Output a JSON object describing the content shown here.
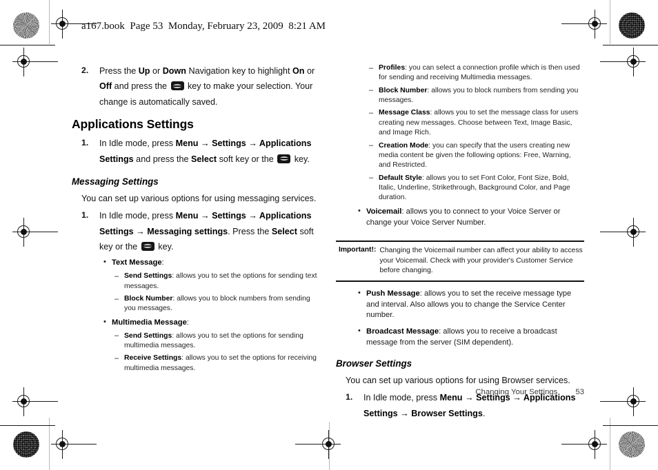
{
  "header": {
    "running_head": "a167.book  Page 53  Monday, February 23, 2009  8:21 AM"
  },
  "left_column": {
    "step2": {
      "number": "2.",
      "seg1": "Press the ",
      "bold1": "Up",
      "seg2": " or ",
      "bold2": "Down",
      "seg3": " Navigation key to highlight ",
      "bold3": "On",
      "seg4": " or ",
      "bold4": "Off",
      "seg5": " and press the ",
      "seg6": " key to make your selection. Your change is automatically saved."
    },
    "applications_settings_heading": "Applications Settings",
    "step_app1": {
      "number": "1.",
      "seg1": "In Idle mode, press ",
      "bold_menu": "Menu",
      "arrow1": " → ",
      "bold_settings": "Settings",
      "arrow2": " → ",
      "bold_appsettings": "Applications Settings",
      "seg2": " and press the ",
      "bold_select": "Select",
      "seg3": " soft key or the ",
      "seg4": " key."
    },
    "messaging_settings_heading": "Messaging Settings",
    "messaging_intro": "You can set up various options for using messaging services.",
    "step_msg1": {
      "number": "1.",
      "seg1": "In Idle mode, press ",
      "bold_menu": "Menu",
      "arrow1": " → ",
      "bold_settings": "Settings",
      "arrow2": " → ",
      "bold_appsettings": "Applications Settings",
      "arrow3": " → ",
      "bold_msgsettings": "Messaging settings",
      "seg2": ". Press the ",
      "bold_select": "Select",
      "seg3": " soft key or the ",
      "seg4": " key."
    },
    "bullets": [
      {
        "mark": "•",
        "term": "Text Message",
        "desc": ":"
      },
      {
        "mark": "–",
        "term": "Send Settings",
        "desc": ": allows you to set the options for sending text messages."
      },
      {
        "mark": "–",
        "term": "Block Number",
        "desc": ": allows you to block numbers from sending you messages."
      },
      {
        "mark": "•",
        "term": "Multimedia Message",
        "desc": ":"
      },
      {
        "mark": "–",
        "term": "Send Settings",
        "desc": ": allows you to set the options for sending multimedia messages."
      },
      {
        "mark": "–",
        "term": "Receive Settings",
        "desc": ": allows you to set the options for receiving multimedia messages."
      }
    ]
  },
  "right_column": {
    "bullets_top": [
      {
        "mark": "–",
        "term": "Profiles",
        "desc": ": you can select a connection profile which is then used for sending and receiving Multimedia messages."
      },
      {
        "mark": "–",
        "term": "Block Number",
        "desc": ": allows you to block numbers from sending you messages."
      },
      {
        "mark": "–",
        "term": "Message Class",
        "desc": ": allows you to set the message class for users creating new messages. Choose between Text, Image Basic, and Image Rich."
      },
      {
        "mark": "–",
        "term": "Creation Mode",
        "desc": ": you can specify that the users creating new media content be given the following options: Free, Warning, and Restricted."
      },
      {
        "mark": "–",
        "term": "Default Style",
        "desc": ": allows you to set Font Color, Font Size, Bold, Italic, Underline, Strikethrough, Background Color, and Page duration."
      },
      {
        "mark": "•",
        "term": "Voicemail",
        "desc": ": allows you to connect to your Voice Server or change your Voice Server Number."
      }
    ],
    "callout": {
      "label": "Important!:",
      "text": "Changing the Voicemail number can affect your ability to access your Voicemail. Check with your provider's Customer Service before changing."
    },
    "bullets_bottom": [
      {
        "mark": "•",
        "term": "Push Message",
        "desc": ": allows you to set the receive message type and interval. Also allows you to change the Service Center number."
      },
      {
        "mark": "•",
        "term": "Broadcast Message",
        "desc": ": allows you to receive a broadcast message from the server (SIM dependent)."
      }
    ],
    "browser_settings_heading": "Browser Settings",
    "browser_intro": "You can set up various options for using Browser services.",
    "step_browser1": {
      "number": "1.",
      "seg1": "In Idle mode, press ",
      "bold_menu": "Menu",
      "arrow1": " → ",
      "bold_settings": "Settings",
      "arrow2": " → ",
      "bold_appsettings": "Applications Settings",
      "arrow3": " → ",
      "bold_browsersettings": "Browser Settings",
      "seg2": "."
    }
  },
  "footer": {
    "title": "Changing Your Settings",
    "page_number": "53"
  },
  "colors": {
    "text": "#121212",
    "page_background": "#ffffff",
    "rule": "#111111",
    "guide_line": "#b9b9b9",
    "footer_text": "#3b3b3b"
  },
  "icons": {
    "key_icon": "phone-select-key-icon",
    "registration_target": "registration-target-icon",
    "color_swatch": "print-color-swatch-icon"
  }
}
